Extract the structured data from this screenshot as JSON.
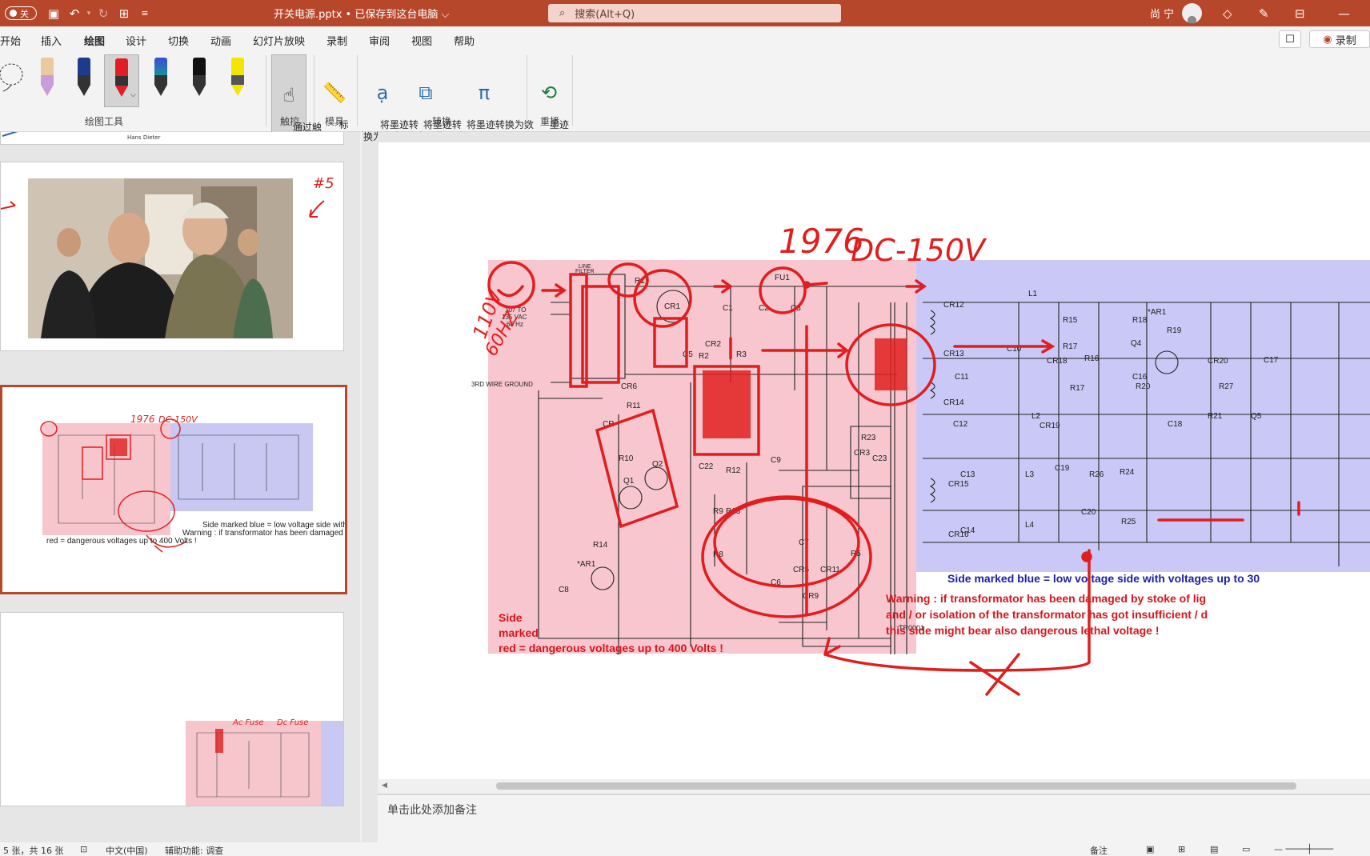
{
  "titlebar": {
    "autosave_label": "关",
    "doc_title": "开关电源.pptx • 已保存到这台电脑 ⌵",
    "search_placeholder": "搜索(Alt+Q)",
    "user_name": "尚 宁"
  },
  "tabs": [
    "开始",
    "插入",
    "绘图",
    "设计",
    "切换",
    "动画",
    "幻灯片放映",
    "录制",
    "审阅",
    "视图",
    "帮助"
  ],
  "active_tab": "绘图",
  "ribbon_right": {
    "record_label": "录制"
  },
  "ribbon": {
    "touch_draw": "通过触\n摸绘制",
    "ruler": "标\n尺",
    "ink_to_text": "将墨迹转\n换为文本",
    "ink_to_shape": "将墨迹转\n换为形状",
    "ink_to_math": "将墨迹转换为数\n学公式(M) ⌵",
    "ink_replay": "墨迹\n重播",
    "groups": {
      "draw_tools": "绘图工具",
      "touch": "触控",
      "stencils": "模具",
      "convert": "转换",
      "replay": "重播"
    },
    "pen_colors": [
      "#e8c9a0",
      "#1e3a8a",
      "#e21d24",
      "#1a8f9e",
      "#111111",
      "#f2e600"
    ]
  },
  "thumbnails": {
    "slide1_caption": "Hans Dieter",
    "slide4_annotations": "#5"
  },
  "notes_placeholder": "单击此处添加备注",
  "status": {
    "slide_of": "5 张，共 16 张",
    "language": "中文(中国)",
    "accessibility": "辅助功能: 调查",
    "notes_btn": "备注"
  },
  "slide": {
    "hand_year": "1976",
    "hand_dc": "DC-150V",
    "hand_ac": "110V",
    "hand_hz": "60HZ",
    "red_side_line1": "Side",
    "red_side_line2": "marked",
    "red_side_line3": "red = dangerous voltages up to 400 Volts !",
    "blue_side": "Side marked blue = low voltage side with voltages up to 30",
    "warning_line1": "Warning : if transformator has been damaged by stoke of lig",
    "warning_line2": "and / or isolation of the transformator has got insufficient / d",
    "warning_line3": "this side might bear also dangerous lethal voltage !",
    "labels_red": [
      "LINE FILTER",
      "107 TO 135 VAC 60 Hz",
      "3RD WIRE GROUND",
      "R1",
      "CR1",
      "FU1",
      "C1",
      "C2",
      "C3",
      "CR2",
      "C5",
      "R2",
      "R3",
      "CR6",
      "R11",
      "C9",
      "R10",
      "Q2",
      "Q1",
      "C22",
      "R12",
      "R9",
      "R13",
      "R8",
      "R14",
      "AR1",
      "C8",
      "C7",
      "CR5",
      "CR11",
      "R5",
      "C6",
      "CR9",
      "R23",
      "CR3",
      "C23",
      "TR0001"
    ],
    "labels_blue": [
      "CR12",
      "L1",
      "R15",
      "R18",
      "AR1",
      "R19",
      "CR13",
      "C10",
      "R17",
      "CR18",
      "R16",
      "Q4",
      "C16",
      "CR20",
      "C17",
      "C11",
      "R17",
      "R20",
      "R27",
      "CR14",
      "L2",
      "C12",
      "CR19",
      "C18",
      "R21",
      "Q5",
      "C13",
      "CR15",
      "L3",
      "C19",
      "R26",
      "R24",
      "C20",
      "R25",
      "CR16",
      "C14",
      "L4"
    ]
  }
}
